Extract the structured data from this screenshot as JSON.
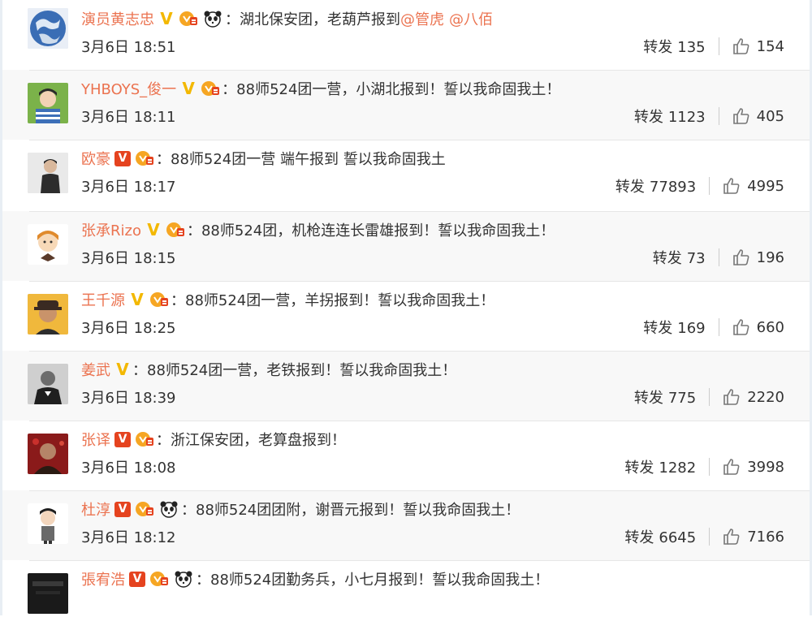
{
  "comments": [
    {
      "username": "演员黄志忠",
      "badges": [
        "v-yellow",
        "member",
        "panda"
      ],
      "content": "：湖北保安团，老葫芦报到",
      "mentions": [
        "@管虎",
        "@八佰"
      ],
      "time": "3月6日 18:51",
      "repost_label": "转发",
      "repost_count": "135",
      "like_count": "154",
      "avatar": "earth-globe"
    },
    {
      "username": "YHBOYS_俊一",
      "badges": [
        "v-yellow",
        "member"
      ],
      "content": "：88师524团一营，小湖北报到！誓以我命固我土！",
      "mentions": [],
      "time": "3月6日 18:11",
      "repost_label": "转发",
      "repost_count": "1123",
      "like_count": "405",
      "avatar": "boy-portrait"
    },
    {
      "username": "欧豪",
      "badges": [
        "v-red",
        "member"
      ],
      "content": "：88师524团一营 端午报到 誓以我命固我土",
      "mentions": [],
      "time": "3月6日 18:17",
      "repost_label": "转发",
      "repost_count": "77893",
      "like_count": "4995",
      "avatar": "man-portrait"
    },
    {
      "username": "张承Rizo",
      "badges": [
        "v-yellow",
        "member"
      ],
      "content": "：88师524团，机枪连连长雷雄报到！誓以我命固我土！",
      "mentions": [],
      "time": "3月6日 18:15",
      "repost_label": "转发",
      "repost_count": "73",
      "like_count": "196",
      "avatar": "cartoon-boy"
    },
    {
      "username": "王千源",
      "badges": [
        "v-yellow",
        "member"
      ],
      "content": "：88师524团一营，羊拐报到！誓以我命固我土！",
      "mentions": [],
      "time": "3月6日 18:25",
      "repost_label": "转发",
      "repost_count": "169",
      "like_count": "660",
      "avatar": "man-hat"
    },
    {
      "username": "姜武",
      "badges": [
        "v-yellow"
      ],
      "content": "：88师524团一营，老铁报到！誓以我命固我土！",
      "mentions": [],
      "time": "3月6日 18:39",
      "repost_label": "转发",
      "repost_count": "775",
      "like_count": "2220",
      "avatar": "man-bw"
    },
    {
      "username": "张译",
      "badges": [
        "v-red",
        "member"
      ],
      "content": "：浙江保安团，老算盘报到！",
      "mentions": [],
      "time": "3月6日 18:08",
      "repost_label": "转发",
      "repost_count": "1282",
      "like_count": "3998",
      "avatar": "man-red"
    },
    {
      "username": "杜淳",
      "badges": [
        "v-red",
        "member",
        "panda"
      ],
      "content": "：88师524团团附，谢晋元报到！誓以我命固我土！",
      "mentions": [],
      "time": "3月6日 18:12",
      "repost_label": "转发",
      "repost_count": "6645",
      "like_count": "7166",
      "avatar": "cartoon-man"
    },
    {
      "username": "張宥浩",
      "badges": [
        "v-red",
        "member",
        "panda"
      ],
      "content": "：88师524团勤务兵，小七月报到！誓以我命固我土！",
      "mentions": [],
      "time": "",
      "repost_label": "",
      "repost_count": "",
      "like_count": "",
      "avatar": "dark-photo"
    }
  ],
  "colors": {
    "username": "#eb7350",
    "text": "#333333",
    "v_yellow": "#f3b800",
    "v_red": "#e5431f"
  }
}
